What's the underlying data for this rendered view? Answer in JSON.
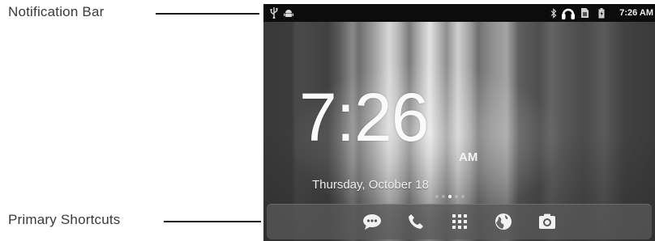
{
  "annotations": {
    "notification_bar": "Notification Bar",
    "primary_shortcuts": "Primary Shortcuts"
  },
  "status_bar": {
    "left_icons": [
      "usb-icon",
      "android-debug-icon"
    ],
    "right_icons": [
      "bluetooth-icon",
      "headset-icon",
      "sim-icon",
      "battery-charging-icon"
    ],
    "time": "7:26 AM"
  },
  "home": {
    "clock_time": "7:26",
    "clock_ampm": "AM",
    "date": "Thursday, October 18",
    "page_count": 5,
    "active_page": 3
  },
  "dock": {
    "icons": [
      "messaging-icon",
      "phone-icon",
      "app-drawer-icon",
      "browser-icon",
      "camera-icon"
    ]
  },
  "colors": {
    "status_bar_bg": "#0c0c0c",
    "text": "#ffffff"
  }
}
